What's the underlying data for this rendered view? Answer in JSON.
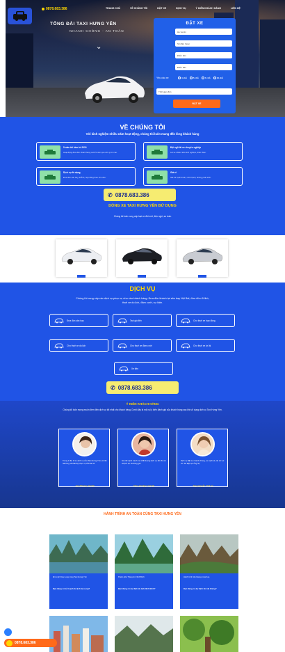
{
  "header": {
    "hotline": "0878.683.386",
    "nav": [
      "TRANG CHỦ",
      "VỀ CHÚNG TÔI",
      "ĐẶT XE",
      "DỊCH VỤ",
      "Ý KIẾN KHÁCH HÀNG",
      "LIÊN HỆ"
    ]
  },
  "hero": {
    "title": "TỔNG ĐÀI TAXI HƯNG YÊN",
    "subtitle": "NHANH CHÓNG - AN TOÀN",
    "booking": {
      "title": "ĐẶT XE",
      "fields": [
        "Họ và tên",
        "Số điện thoại",
        "Điểm đón",
        "Điểm đến"
      ],
      "car_label": "Yêu cầu xe",
      "car_options": [
        "4 chỗ",
        "5 chỗ",
        "7 chỗ",
        "16 chỗ"
      ],
      "time_label": "Thời gian đón",
      "submit": "ĐẶT XE"
    }
  },
  "about": {
    "title": "VỀ CHÚNG TÔI",
    "intro": "Với kinh nghiệm nhiều năm hoạt động, chúng tôi luôn mang đến lòng khách hàng",
    "features": [
      {
        "title": "5 năm tối kém từ 2019",
        "desc": "Hoạt động đưa đón khách hàng suốt 5 năm qua với uy tín cao."
      },
      {
        "title": "Đội ngũ lái xe chuyên nghiệp",
        "desc": "Lái xe nhiều năm kinh nghiệm, thân thiện."
      },
      {
        "title": "Dịch vụ đa dạng",
        "desc": "Đưa đón sân bay, đi tỉnh, hợp đồng theo nhu cầu."
      },
      {
        "title": "Giá rẻ",
        "desc": "Giá cả cạnh tranh, minh bạch, không phát sinh."
      }
    ],
    "phone": "0878.683.386",
    "tagline": "DÒNG XE TAXI HƯNG YÊN BỬ DỤNG",
    "note": "Chúng tôi luôn cung cấp loại xe đời mới, tiện nghi, an toàn"
  },
  "services": {
    "title": "DỊCH VỤ",
    "intro": "Chúng tôi cung cấp các dịch vụ phục vụ nhu cầu khách hàng: Đưa đón khách tại sân bay Nội Bài, đưa đón đi tỉnh, thuê xe du lịch, đám cưới, sự kiện.",
    "items": [
      "Đưa đón sân bay",
      "Taxi giá tỉnh",
      "Cho thuê xe hợp đồng",
      "Cho thuê xe du lịch",
      "Cho thuê xe đám cưới",
      "Cho thuê xe tự lái",
      "Xe tiện"
    ],
    "phone": "0878.683.386"
  },
  "reviews": {
    "title": "Ý KIẾN KHÁCH HÀNG",
    "intro": "Chúng tôi luôn mong muốn đem đến dịch vụ tốt nhất cho khách hàng. Dưới đây là một số ý kiến đánh giá của khách hàng sau khi sử dụng dịch vụ Taxi Hưng Yên.",
    "items": [
      {
        "text": "Trong 1 lần đi xe dịch vụ của Taxi Hưng Yên, tôi rất hài lòng về thái độ phục vụ của tài xế.",
        "name": "Jung Phuong / Hà Nội"
      },
      {
        "text": "Giá rất cạnh tranh mà chất lượng dịch vụ rất tốt, tài xế lịch sự và đúng giờ.",
        "name": "Trần Linh Ngọc / Hà Nội"
      },
      {
        "text": "Dịch vụ đặt xe nhanh chóng, xe sạch sẽ, tài xế vui vẻ. Sẽ tiếp tục ủng hộ.",
        "name": "Trang Nguyễn / Phố Cổ"
      }
    ]
  },
  "blog": {
    "title": "HÀNH TRÌNH AN TOÀN CÙNG TAXI HƯNG YÊN",
    "posts": [
      {
        "title": "Đi du lịch Hạ Long cùng Taxi Hưng Yên",
        "desc": "Bạn đang có kế hoạch du lịch Hạ Long?"
      },
      {
        "title": "Khám phá Tràng An Ninh Bình",
        "desc": "Bạn đang có dự định du lịch Ninh Bình?"
      },
      {
        "title": "Hành trình Hà Giang mùa hoa",
        "desc": "Bạn đang có dự định lên Hà Giang?"
      }
    ]
  },
  "float": {
    "call": "0878.683.386"
  }
}
